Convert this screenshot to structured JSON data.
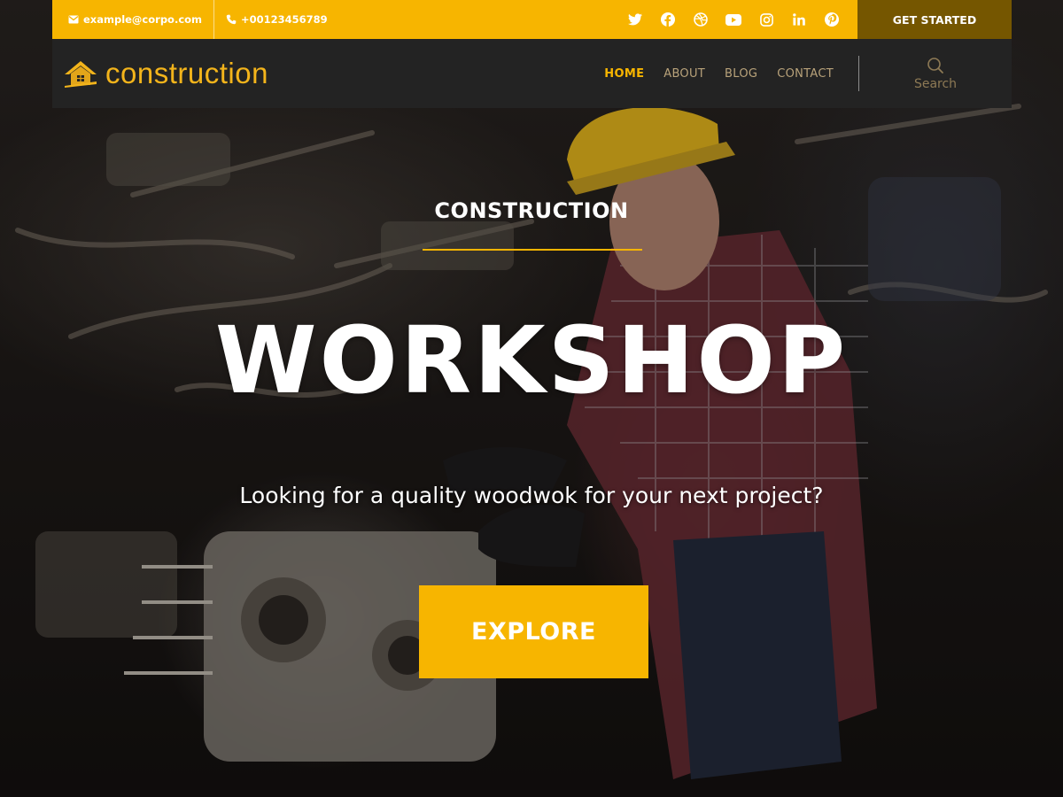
{
  "topbar": {
    "email": "example@corpo.com",
    "phone": "+00123456789",
    "socials": [
      "twitter-icon",
      "facebook-icon",
      "dribbble-icon",
      "youtube-icon",
      "instagram-icon",
      "linkedin-icon",
      "pinterest-icon"
    ],
    "cta_label": "GET STARTED"
  },
  "navbar": {
    "logo_text": "construction",
    "items": [
      {
        "label": "HOME",
        "active": true
      },
      {
        "label": "ABOUT",
        "active": false
      },
      {
        "label": "BLOG",
        "active": false
      },
      {
        "label": "CONTACT",
        "active": false
      }
    ],
    "search_label": "Search"
  },
  "hero": {
    "kicker": "CONSTRUCTION",
    "headline": "WORKSHOP",
    "subline": "Looking for a quality woodwok for your next project?",
    "button_label": "EXPLORE"
  },
  "colors": {
    "accent": "#f7b500",
    "accent_dark": "#755600",
    "nav_bg": "#232323"
  }
}
